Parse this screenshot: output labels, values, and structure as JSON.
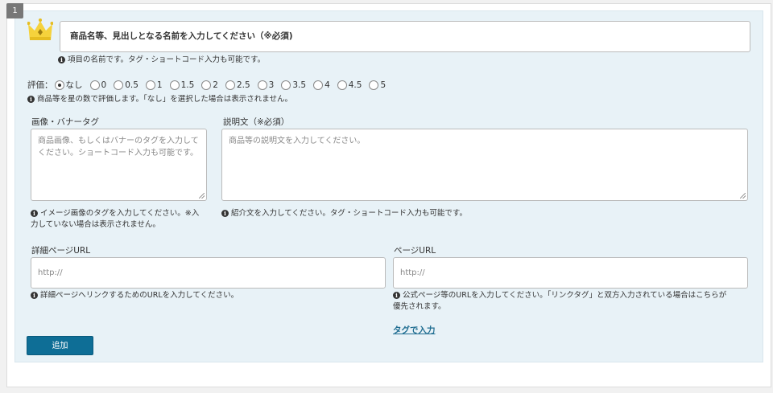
{
  "block_number": "1",
  "title_field": {
    "placeholder": "商品名等、見出しとなる名前を入力してください（※必須)"
  },
  "title_hint": "項目の名前です。タグ・ショートコード入力も可能です。",
  "rating": {
    "label": "評価：",
    "options": [
      "なし",
      "0",
      "0.5",
      "1",
      "1.5",
      "2",
      "2.5",
      "3",
      "3.5",
      "4",
      "4.5",
      "5"
    ],
    "selected": "なし",
    "hint": "商品等を星の数で評価します。「なし」を選択した場合は表示されません。"
  },
  "image_field": {
    "label": "画像・バナータグ",
    "placeholder": "商品画像、もしくはバナーのタグを入力してください。ショートコード入力も可能です。",
    "hint_line1": "イメージ画像のタグを入力してください。※入",
    "hint_line2": "力していない場合は表示されません。"
  },
  "description_field": {
    "label": "説明文（※必須）",
    "placeholder": "商品等の説明文を入力してください。",
    "hint": "紹介文を入力してください。タグ・ショートコード入力も可能です。"
  },
  "detail_url_field": {
    "label": "詳細ページURL",
    "placeholder": "http://",
    "hint": "詳細ページへリンクするためのURLを入力してください。"
  },
  "page_url_field": {
    "label": "ページURL",
    "placeholder": "http://",
    "hint_line1": "公式ページ等のURLを入力してください。「リンクタグ」と双方入力されている場合はこちらが",
    "hint_line2": "優先されます。"
  },
  "tag_input_link": "タグで入力",
  "add_button": "追加",
  "colors": {
    "accent": "#0e6e96",
    "panel_bg": "#e8f2f7",
    "crown": "#f5d23c"
  },
  "icons": {
    "header": "crown-icon",
    "hint": "info-icon"
  }
}
